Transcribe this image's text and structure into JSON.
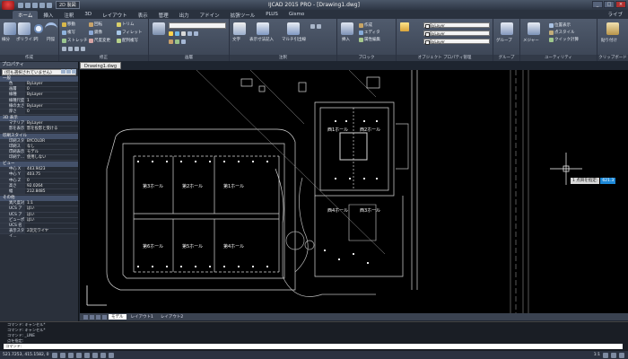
{
  "window": {
    "title": "IJCAD 2015 PRO - [Drawing1.dwg]",
    "quick_access_label": "2D 製図",
    "controls": [
      "_",
      "□",
      "×"
    ]
  },
  "ribbon_tabs": [
    "ホーム",
    "挿入",
    "注釈",
    "3D",
    "レイアウト",
    "表示",
    "管理",
    "出力",
    "アドイン",
    "拡張ツール",
    "PLUS",
    "Gismo"
  ],
  "ribbon_tab_right": "ライブ",
  "ribbon": {
    "draw_group": {
      "label": "作成",
      "items": [
        "線分",
        "ポリライン",
        "円",
        "円弧"
      ]
    },
    "modify_group": {
      "label": "修正",
      "items": [
        "移動",
        "複写",
        "ストレッチ",
        "回転",
        "鏡像",
        "尺度変更",
        "トリム",
        "フィレット",
        "配列複写"
      ]
    },
    "layer_group": {
      "label": "画層"
    },
    "annotation_group": {
      "label": "注釈",
      "items": [
        "文字",
        "表示寸法記入",
        "マルチ引出線"
      ]
    },
    "block_group": {
      "label": "ブロック",
      "items": [
        "挿入",
        "作成",
        "エディタ",
        "属性編集"
      ]
    },
    "properties_group": {
      "label": "オブジェクト プロパティ管理",
      "items": [
        "ByLayer",
        "ByLayer",
        "ByLayer"
      ]
    },
    "group_group": {
      "label": "グループ",
      "items": [
        "グループ"
      ]
    },
    "utility_group": {
      "label": "ユーティリティ",
      "items": [
        "メジャー",
        "位置表示",
        "点スタイル",
        "クイック計算"
      ]
    },
    "clipboard_group": {
      "label": "クリップボード",
      "items": [
        "貼り付け"
      ]
    }
  },
  "properties_panel": {
    "title": "プロパティ",
    "selection": "(何も選択されていません)",
    "sections": [
      {
        "name": "一般",
        "rows": [
          {
            "k": "色",
            "v": "ByLayer"
          },
          {
            "k": "画層",
            "v": "0"
          },
          {
            "k": "線種",
            "v": "ByLayer"
          },
          {
            "k": "線種尺度",
            "v": "1"
          },
          {
            "k": "線の太さ",
            "v": "ByLayer"
          },
          {
            "k": "厚さ",
            "v": "0"
          }
        ]
      },
      {
        "name": "3D 表示",
        "rows": [
          {
            "k": "マテリアル",
            "v": "ByLayer"
          },
          {
            "k": "影を表示",
            "v": "影を投影と受ける"
          }
        ]
      },
      {
        "name": "印刷スタイル",
        "rows": [
          {
            "k": "印刷スタイル",
            "v": "BYCOLOR"
          },
          {
            "k": "印刷スタ…",
            "v": "なし"
          },
          {
            "k": "印刷表示",
            "v": "モデル"
          },
          {
            "k": "印刷テ…",
            "v": "使用しない"
          }
        ]
      },
      {
        "name": "ビュー",
        "rows": [
          {
            "k": "中心 X",
            "v": "443.9423"
          },
          {
            "k": "中心 Y",
            "v": "403.75"
          },
          {
            "k": "中心 Z",
            "v": "0"
          },
          {
            "k": "高さ",
            "v": "92.0264"
          },
          {
            "k": "幅",
            "v": "212.8485"
          }
        ]
      },
      {
        "name": "その他",
        "rows": [
          {
            "k": "異尺度対",
            "v": "1:1"
          },
          {
            "k": "UCS アイ…",
            "v": "はい"
          },
          {
            "k": "UCS アイ…",
            "v": "はい"
          },
          {
            "k": "ビューポー…",
            "v": "はい"
          },
          {
            "k": "UCS 名",
            "v": ""
          },
          {
            "k": "表示スタイ…",
            "v": "2次元ワイヤ"
          }
        ]
      }
    ]
  },
  "document_tab": "Drawing1.dwg",
  "drawing_labels": {
    "halls": [
      "第3ホール",
      "第2ホール",
      "第1ホール",
      "第6ホール",
      "第5ホール",
      "第4ホール"
    ],
    "west_halls": [
      "西1ホール",
      "西2ホール",
      "西4ホール",
      "西3ホール"
    ]
  },
  "layout_tabs": [
    "モデル",
    "レイアウト1",
    "レイアウト2"
  ],
  "command_history": [
    "コマンド: キャンセル*",
    "コマンド: キャンセル*",
    "コマンド: _LINE",
    "点を指定:"
  ],
  "command_prompt": "コマンド:",
  "cursor_tooltip": {
    "label": "1 点目を指定:",
    "value": "621.3"
  },
  "status": {
    "coords": "521.7253, 415.1582, 0",
    "scale": "1:1"
  }
}
